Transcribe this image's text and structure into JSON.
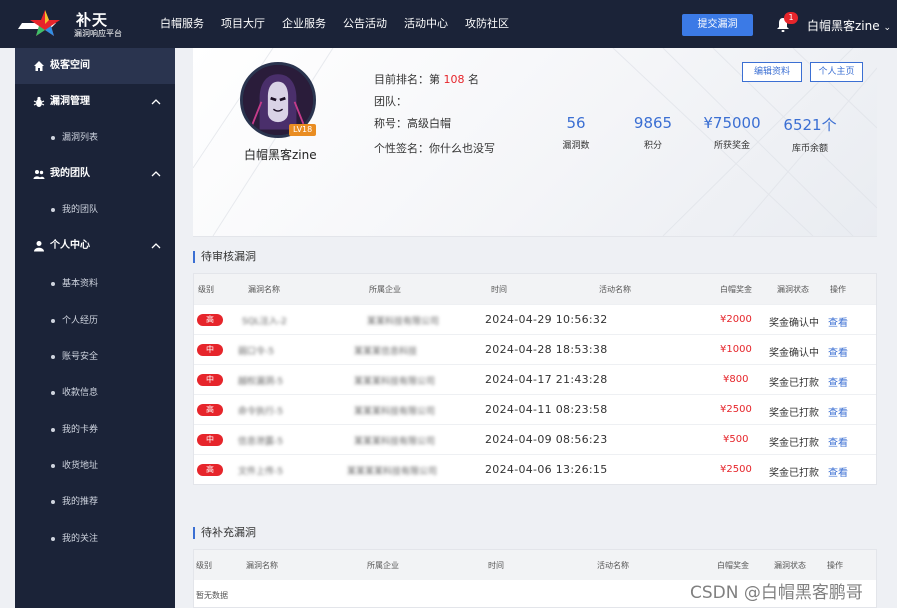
{
  "brand": {
    "title": "补天",
    "subtitle": "漏洞响应平台"
  },
  "nav": {
    "items": [
      "白帽服务",
      "项目大厅",
      "企业服务",
      "公告活动",
      "活动中心",
      "攻防社区"
    ],
    "submit_label": "提交漏洞",
    "notification_count": "1",
    "user_name": "白帽黑客zine"
  },
  "sidebar": {
    "top_item": "极客空间",
    "groups": [
      {
        "label": "漏洞管理",
        "items": [
          "漏洞列表"
        ]
      },
      {
        "label": "我的团队",
        "items": [
          "我的团队"
        ]
      },
      {
        "label": "个人中心",
        "items": [
          "基本资料",
          "个人经历",
          "账号安全",
          "收款信息",
          "我的卡券",
          "收货地址",
          "我的推荐",
          "我的关注"
        ]
      }
    ]
  },
  "profile": {
    "name": "白帽黑客zine",
    "level": "LV18",
    "rank_prefix": "目前排名：第",
    "rank_value": "108",
    "rank_suffix": "名",
    "team_label": "团队：",
    "title_label": "称号：高级白帽",
    "signature": "个性签名：你什么也没写",
    "edit_button": "编辑资料",
    "homepage_button": "个人主页",
    "stats": [
      {
        "value": "56",
        "label": "漏洞数"
      },
      {
        "value": "9865",
        "label": "积分"
      },
      {
        "value": "¥75000",
        "label": "所获奖金"
      },
      {
        "value": "6521个",
        "label": "库币余额"
      }
    ],
    "icons": [
      "phone-icon",
      "image-icon",
      "id-card-icon"
    ]
  },
  "pending": {
    "title": "待审核漏洞",
    "columns": [
      "级别",
      "漏洞名称",
      "所属企业",
      "时间",
      "活动名称",
      "白帽奖金",
      "漏洞状态",
      "操作"
    ],
    "rows": [
      {
        "level": "高",
        "name": "SQL注入-2",
        "company": "某某科技有限公司",
        "time": "2024-04-29 10:56:32",
        "bonus": "¥2000",
        "status": "奖金确认中",
        "action": "查看"
      },
      {
        "level": "中",
        "name": "弱口令-5",
        "company": "某某某信息科技",
        "time": "2024-04-28 18:53:38",
        "bonus": "¥1000",
        "status": "奖金确认中",
        "action": "查看"
      },
      {
        "level": "中",
        "name": "越权漏洞-5",
        "company": "某某某科技有限公司",
        "time": "2024-04-17 21:43:28",
        "bonus": "¥800",
        "status": "奖金已打款",
        "action": "查看"
      },
      {
        "level": "高",
        "name": "命令执行-5",
        "company": "某某某科技有限公司",
        "time": "2024-04-11 08:23:58",
        "bonus": "¥2500",
        "status": "奖金已打款",
        "action": "查看"
      },
      {
        "level": "中",
        "name": "信息泄露-5",
        "company": "某某某科技有限公司",
        "time": "2024-04-09 08:56:23",
        "bonus": "¥500",
        "status": "奖金已打款",
        "action": "查看"
      },
      {
        "level": "高",
        "name": "文件上传-5",
        "company": "某某某某科技有限公司",
        "time": "2024-04-06 13:26:15",
        "bonus": "¥2500",
        "status": "奖金已打款",
        "action": "查看"
      }
    ]
  },
  "supplement": {
    "title": "待补充漏洞",
    "columns": [
      "级别",
      "漏洞名称",
      "所属企业",
      "时间",
      "活动名称",
      "白帽奖金",
      "漏洞状态",
      "操作"
    ],
    "empty_text": "暂无数据"
  },
  "watermark": "CSDN @白帽黑客鹏哥",
  "colors": {
    "nav_bg": "#1b2338",
    "accent": "#3b6fd3",
    "danger": "#e6252b"
  }
}
